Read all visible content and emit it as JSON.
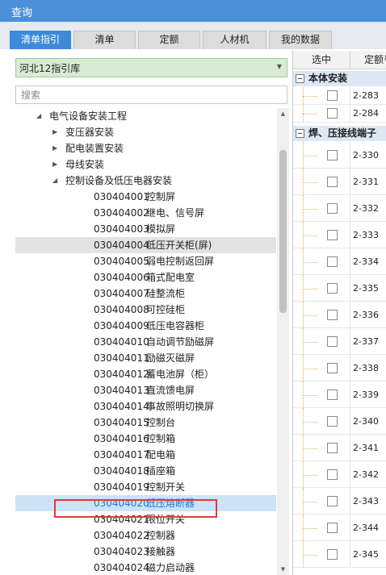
{
  "window": {
    "title": "查询"
  },
  "tabs": [
    {
      "label": "清单指引",
      "active": true
    },
    {
      "label": "清单",
      "active": false
    },
    {
      "label": "定额",
      "active": false
    },
    {
      "label": "人材机",
      "active": false
    },
    {
      "label": "我的数据",
      "active": false
    }
  ],
  "library": {
    "selected": "河北12指引库"
  },
  "search": {
    "placeholder": "搜索",
    "value": ""
  },
  "tree": {
    "root": "电气设备安装工程",
    "groups": [
      "变压器安装",
      "配电装置安装",
      "母线安装"
    ],
    "open_group": "控制设备及低压电器安装",
    "items": [
      {
        "code": "030404001",
        "name": "控制屏"
      },
      {
        "code": "030404002",
        "name": "继电、信号屏"
      },
      {
        "code": "030404003",
        "name": "模拟屏"
      },
      {
        "code": "030404004",
        "name": "低压开关柜(屏)"
      },
      {
        "code": "030404005",
        "name": "弱电控制返回屏"
      },
      {
        "code": "030404006",
        "name": "箱式配电室"
      },
      {
        "code": "030404007",
        "name": "硅整流柜"
      },
      {
        "code": "030404008",
        "name": "可控硅柜"
      },
      {
        "code": "030404009",
        "name": "低压电容器柜"
      },
      {
        "code": "030404010",
        "name": "自动调节励磁屏"
      },
      {
        "code": "030404011",
        "name": "励磁灭磁屏"
      },
      {
        "code": "030404012",
        "name": "蓄电池屏（柜）"
      },
      {
        "code": "030404013",
        "name": "直流馈电屏"
      },
      {
        "code": "030404014",
        "name": "事故照明切换屏"
      },
      {
        "code": "030404015",
        "name": "控制台"
      },
      {
        "code": "030404016",
        "name": "控制箱"
      },
      {
        "code": "030404017",
        "name": "配电箱"
      },
      {
        "code": "030404018",
        "name": "插座箱"
      },
      {
        "code": "030404019",
        "name": "控制开关"
      },
      {
        "code": "030404020",
        "name": "低压熔断器"
      },
      {
        "code": "030404021",
        "name": "限位开关"
      },
      {
        "code": "030404022",
        "name": "控制器"
      },
      {
        "code": "030404023",
        "name": "接触器"
      },
      {
        "code": "030404024",
        "name": "磁力启动器"
      }
    ],
    "hover_code": "030404004",
    "selected_code": "030404020"
  },
  "right": {
    "columns": [
      "选中",
      "定额号"
    ],
    "groups": [
      {
        "title": "本体安装",
        "rows": [
          "2-283",
          "2-284"
        ]
      },
      {
        "title": "焊、压接线端子",
        "rows": [
          "2-330",
          "2-331",
          "2-332",
          "2-333",
          "2-334",
          "2-335",
          "2-336",
          "2-337",
          "2-338",
          "2-339",
          "2-340",
          "2-341",
          "2-342",
          "2-343",
          "2-344",
          "2-345"
        ]
      }
    ]
  },
  "colors": {
    "title_bar": "#4a90d9",
    "active_tab": "#3d8ad8",
    "selected_row": "#cde3f7",
    "highlight_box": "#e53935"
  }
}
